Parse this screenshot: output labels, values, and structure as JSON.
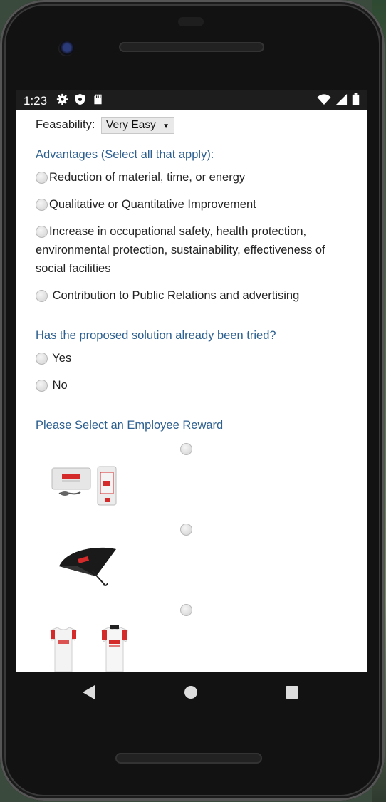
{
  "status_bar": {
    "time": "1:23",
    "left_icons": [
      "gear-icon",
      "shield-icon",
      "sd-card-icon"
    ],
    "right_icons": [
      "wifi-icon",
      "signal-icon",
      "battery-icon"
    ]
  },
  "form": {
    "feasibility": {
      "label": "Feasability:",
      "selected": "Very Easy"
    },
    "advantages": {
      "title": "Advantages (Select all that apply):",
      "options": [
        "Reduction of material, time, or energy",
        "Qualitative or Quantitative Improvement",
        "Increase in occupational safety, health protection, environmental protection, sustainability, effectiveness of social facilities",
        " Contribution to Public Relations and advertising"
      ]
    },
    "tried": {
      "title": "Has the proposed solution already been tried?",
      "options": [
        " Yes",
        " No"
      ]
    },
    "reward": {
      "title": "Please Select an Employee Reward",
      "options": [
        "power-bank-product-image",
        "umbrella-product-image",
        "tshirt-product-image"
      ]
    }
  },
  "nav_bar": {
    "buttons": [
      "back-icon",
      "home-icon",
      "recents-icon"
    ]
  },
  "colors": {
    "section_title": "#2c5f8f",
    "brand_red": "#d42a2a"
  }
}
